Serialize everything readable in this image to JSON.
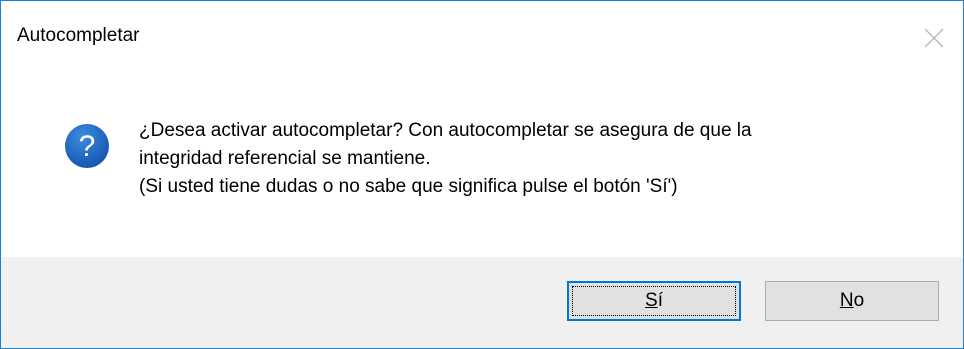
{
  "window": {
    "title": "Autocompletar"
  },
  "icon": {
    "name": "question-icon",
    "color": "#1c67c4",
    "glyph": "?"
  },
  "message": {
    "line1": "¿Desea activar autocompletar? Con autocompletar se asegura de que la",
    "line2": "integridad referencial se mantiene.",
    "line3": "(Si usted tiene dudas o no sabe que significa pulse el botón 'Sí')"
  },
  "buttons": {
    "yes": {
      "mnemonic": "S",
      "rest": "í",
      "is_default": true
    },
    "no": {
      "mnemonic": "N",
      "rest": "o"
    }
  },
  "colors": {
    "accent": "#0078d7",
    "footer_bg": "#f0f0f0",
    "button_bg": "#e1e1e1"
  }
}
